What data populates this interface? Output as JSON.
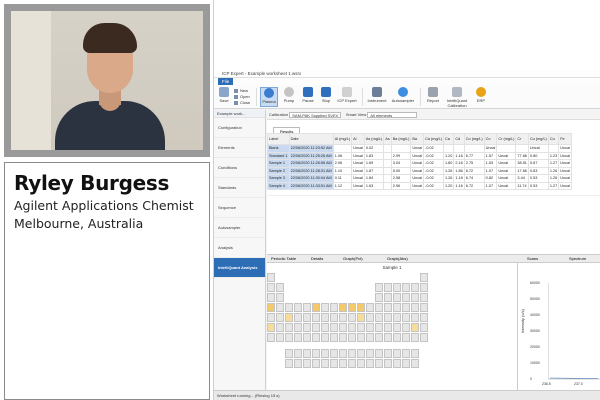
{
  "presenter": {
    "name": "Ryley Burgess",
    "role": "Agilent Applications Chemist",
    "location": "Melbourne, Australia"
  },
  "app": {
    "title": "ICP Expert - Example worksheet 1.wsrx",
    "menu_file": "File",
    "ribbon": {
      "save": "Save",
      "new": "New",
      "open": "Open",
      "close": "Close",
      "plasma": "Plasma",
      "pump": "Pump",
      "pause": "Pause",
      "stop": "Stop",
      "icp_expert": "ICP Expert",
      "instrument": "Instrument",
      "autosampler": "Autosampler",
      "report": "Report",
      "intelliquant_cal": "IntelliQuant Calibration",
      "erp": "ERP"
    },
    "workspace_name": "Example work...",
    "nav": [
      "Configuration",
      "Elements",
      "Conditions",
      "Standards",
      "Sequence",
      "Autosampler",
      "Analysis",
      "IntelliQuant Analysis"
    ],
    "calibration_label": "Calibration",
    "calibration_value": "SAM-PAK Supplied SVEV",
    "smart_view_label": "Smart View",
    "smart_view_value": "All elements",
    "results_tab": "Results",
    "table": {
      "headers": [
        "Label",
        "Date",
        "Al (mg/L)",
        "Al",
        "As (mg/L)",
        "As",
        "Ba (mg/L)",
        "Ba",
        "Ca (mg/L)",
        "Ca",
        "Cd",
        "Co (mg/L)",
        "Co",
        "Cr (mg/L)",
        "Cr",
        "Cu (mg/L)",
        "Cu",
        "Fe"
      ],
      "rows": [
        [
          "Blank",
          "22/06/2020 11:23:52 AM",
          "",
          "Uncal",
          "0.02",
          "",
          "",
          "Uncal",
          "-0.02",
          "",
          "",
          "",
          "Uncal",
          "",
          "",
          "Uncal",
          "",
          "Uncal"
        ],
        [
          "Standard 1",
          "22/06/2020 11:25:26 AM",
          "1.06",
          "Uncal",
          "1.83",
          "",
          "2.99",
          "Uncal",
          "-0.02",
          "1.20",
          "1.16",
          "6.77",
          "1.57",
          "Uncal",
          "77.66",
          "0.80",
          "1.23",
          "Uncal"
        ],
        [
          "Sample 1",
          "22/06/2020 11:26:56 AM",
          "2.06",
          "Uncal",
          "1.69",
          "",
          "3.04",
          "Uncal",
          "-0.02",
          "1.80",
          "2.16",
          "2.75",
          "1.53",
          "Uncal",
          "38.51",
          "0.67",
          "1.27",
          "Uncal"
        ],
        [
          "Sample 2",
          "22/06/2020 11:28:31 AM",
          "1.10",
          "Uncal",
          "1.87",
          "",
          "5.00",
          "Uncal",
          "-0.02",
          "1.26",
          "1.86",
          "6.72",
          "1.07",
          "Uncal",
          "17.66",
          "0.63",
          "1.26",
          "Uncal"
        ],
        [
          "Sample 3",
          "22/06/2020 11:30:04 AM",
          "0.11",
          "Uncal",
          "1.84",
          "",
          "2.98",
          "Uncal",
          "-0.02",
          "1.26",
          "1.18",
          "6.74",
          "0.82",
          "Uncal",
          "3.44",
          "0.53",
          "1.26",
          "Uncal"
        ],
        [
          "Sample 4",
          "22/06/2020 11:33:51 AM",
          "1.12",
          "Uncal",
          "1.63",
          "",
          "2.96",
          "Uncal",
          "-0.02",
          "1.20",
          "1.16",
          "6.72",
          "1.07",
          "Uncal",
          "11.74",
          "0.53",
          "1.27",
          "Uncal"
        ]
      ]
    },
    "lower_tabs": [
      "Periodic Table",
      "Details",
      "Graph(Pct)",
      "Graph(Abs)"
    ],
    "right_tabs": [
      "Scans",
      "Spectrum"
    ],
    "periodic_title": "Sample 1",
    "spectrum": {
      "ylabel": "Intensity (c/s)",
      "yticks": [
        "60000",
        "50000",
        "40000",
        "30000",
        "20000",
        "10000",
        "0"
      ],
      "xticks": [
        "236.5",
        "237.0"
      ]
    },
    "status": "Worksheet running... (Rinsing 15 s)"
  }
}
